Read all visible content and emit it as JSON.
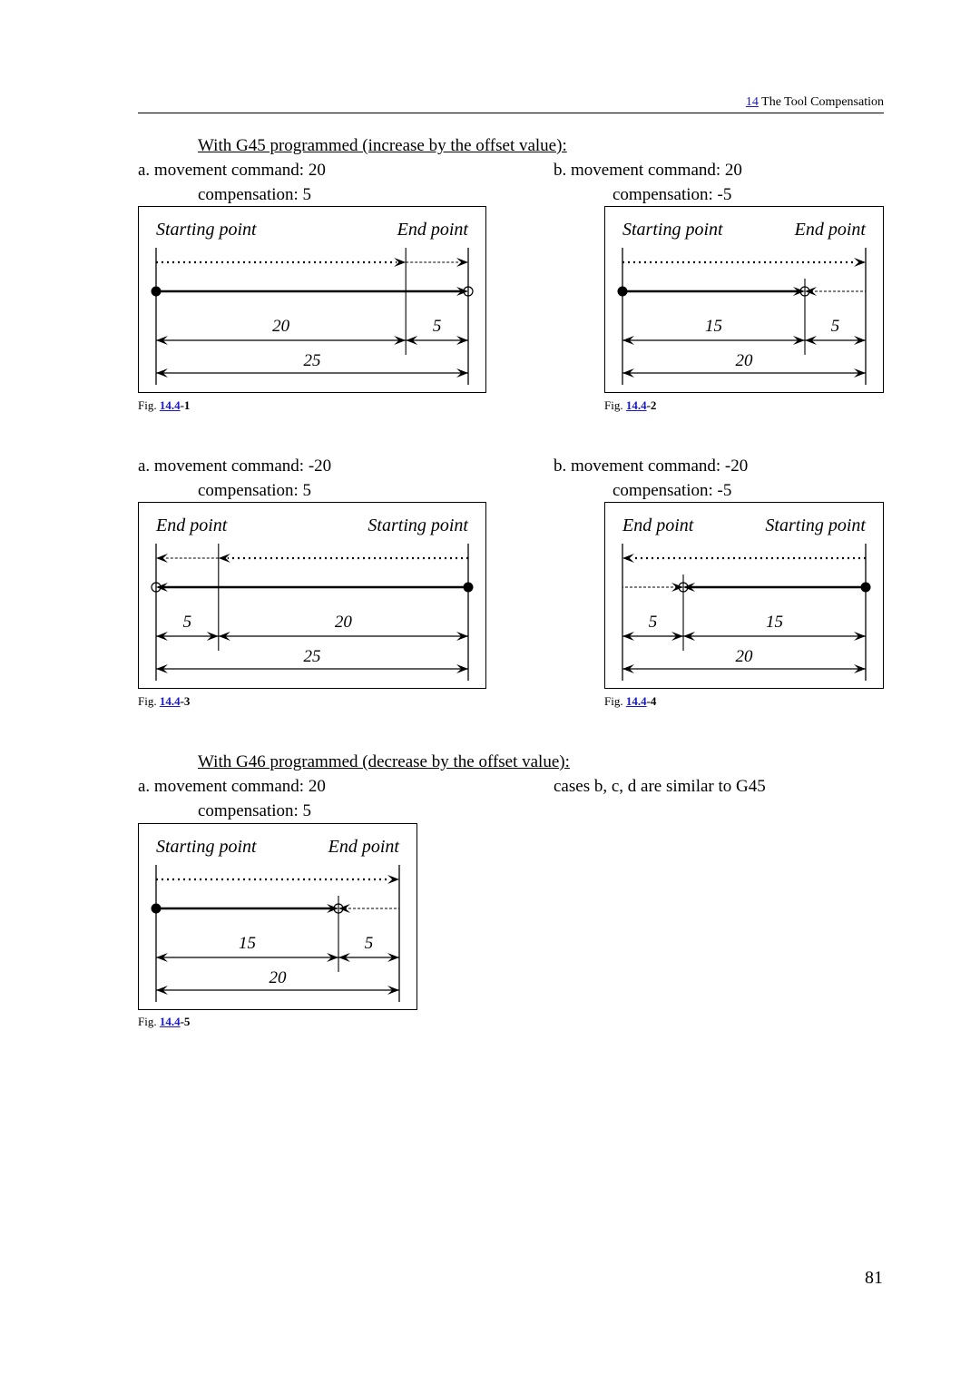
{
  "header": {
    "chapter_num": "14",
    "chapter_title": "The Tool Compensation"
  },
  "section_g45": {
    "heading": "With G45 programmed (increase by the offset value):",
    "cases": [
      {
        "title": "a. movement command: 20",
        "comp": "compensation: 5",
        "caption_prefix": "Fig.",
        "caption_num": "14.4",
        "caption_suffix": "-1"
      },
      {
        "title": "b. movement command: 20",
        "comp": "compensation: -5",
        "caption_prefix": "Fig.",
        "caption_num": "14.4",
        "caption_suffix": "-2"
      },
      {
        "title": "a. movement command: -20",
        "comp": "compensation: 5",
        "caption_prefix": "Fig.",
        "caption_num": "14.4",
        "caption_suffix": "-3"
      },
      {
        "title": "b. movement command: -20",
        "comp": "compensation: -5",
        "caption_prefix": "Fig.",
        "caption_num": "14.4",
        "caption_suffix": "-4"
      }
    ]
  },
  "section_g46": {
    "heading": "With G46 programmed (decrease by the offset value):",
    "case_a": {
      "title": "a. movement command: 20",
      "comp": "compensation: 5",
      "caption_prefix": "Fig.",
      "caption_num": "14.4",
      "caption_suffix": "-5"
    },
    "note": "cases b, c, d are similar to G45"
  },
  "figures": [
    {
      "id": "fig-1",
      "direction": "right",
      "start_label": "Starting point",
      "end_label": "End point",
      "command": 20,
      "offset": 5,
      "result": 25,
      "seg_labels": [
        "20",
        "5"
      ],
      "total_label": "25"
    },
    {
      "id": "fig-2",
      "direction": "right",
      "start_label": "Starting point",
      "end_label": "End point",
      "command": 20,
      "offset": -5,
      "result": 15,
      "seg_labels": [
        "15",
        "5"
      ],
      "total_label": "20"
    },
    {
      "id": "fig-3",
      "direction": "left",
      "start_label": "Starting point",
      "end_label": "End point",
      "command": -20,
      "offset": 5,
      "result": -25,
      "seg_labels": [
        "5",
        "20"
      ],
      "total_label": "25"
    },
    {
      "id": "fig-4",
      "direction": "left",
      "start_label": "Starting point",
      "end_label": "End point",
      "command": -20,
      "offset": -5,
      "result": -15,
      "seg_labels": [
        "5",
        "15"
      ],
      "total_label": "20"
    },
    {
      "id": "fig-5",
      "direction": "right",
      "start_label": "Starting point",
      "end_label": "End point",
      "command": 20,
      "offset": 5,
      "result": 15,
      "seg_labels": [
        "15",
        "5"
      ],
      "total_label": "20"
    }
  ],
  "page_number": "81"
}
